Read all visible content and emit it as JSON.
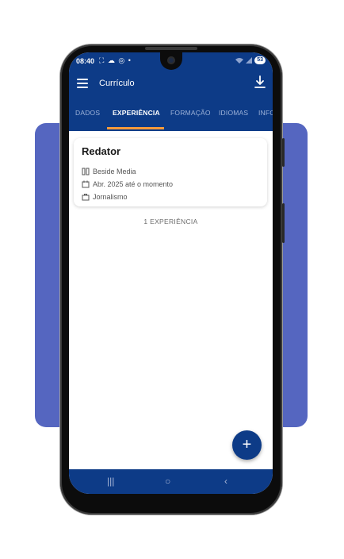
{
  "status_bar": {
    "time": "08:40",
    "notification_icons": [
      "screenshot-icon",
      "cloud-icon",
      "chrome-icon",
      "dot-icon"
    ],
    "battery": "53"
  },
  "toolbar": {
    "title": "Currículo",
    "menu_icon": "menu-icon",
    "download_icon": "download-icon"
  },
  "tabs": [
    {
      "label": "DADOS",
      "active": false
    },
    {
      "label": "EXPERIÊNCIA",
      "active": true
    },
    {
      "label": "FORMAÇÃO",
      "active": false
    },
    {
      "label": "IDIOMAS",
      "active": false
    },
    {
      "label": "INFO",
      "active": false
    }
  ],
  "experience": {
    "title": "Redator",
    "company": "Beside Media",
    "period": "Abr. 2025 até o momento",
    "area": "Jornalismo"
  },
  "count_label": "1 EXPERIÊNCIA",
  "fab_label": "+",
  "colors": {
    "primary": "#0d3b87",
    "accent": "#f59a3b",
    "backdrop": "#5566c0"
  }
}
